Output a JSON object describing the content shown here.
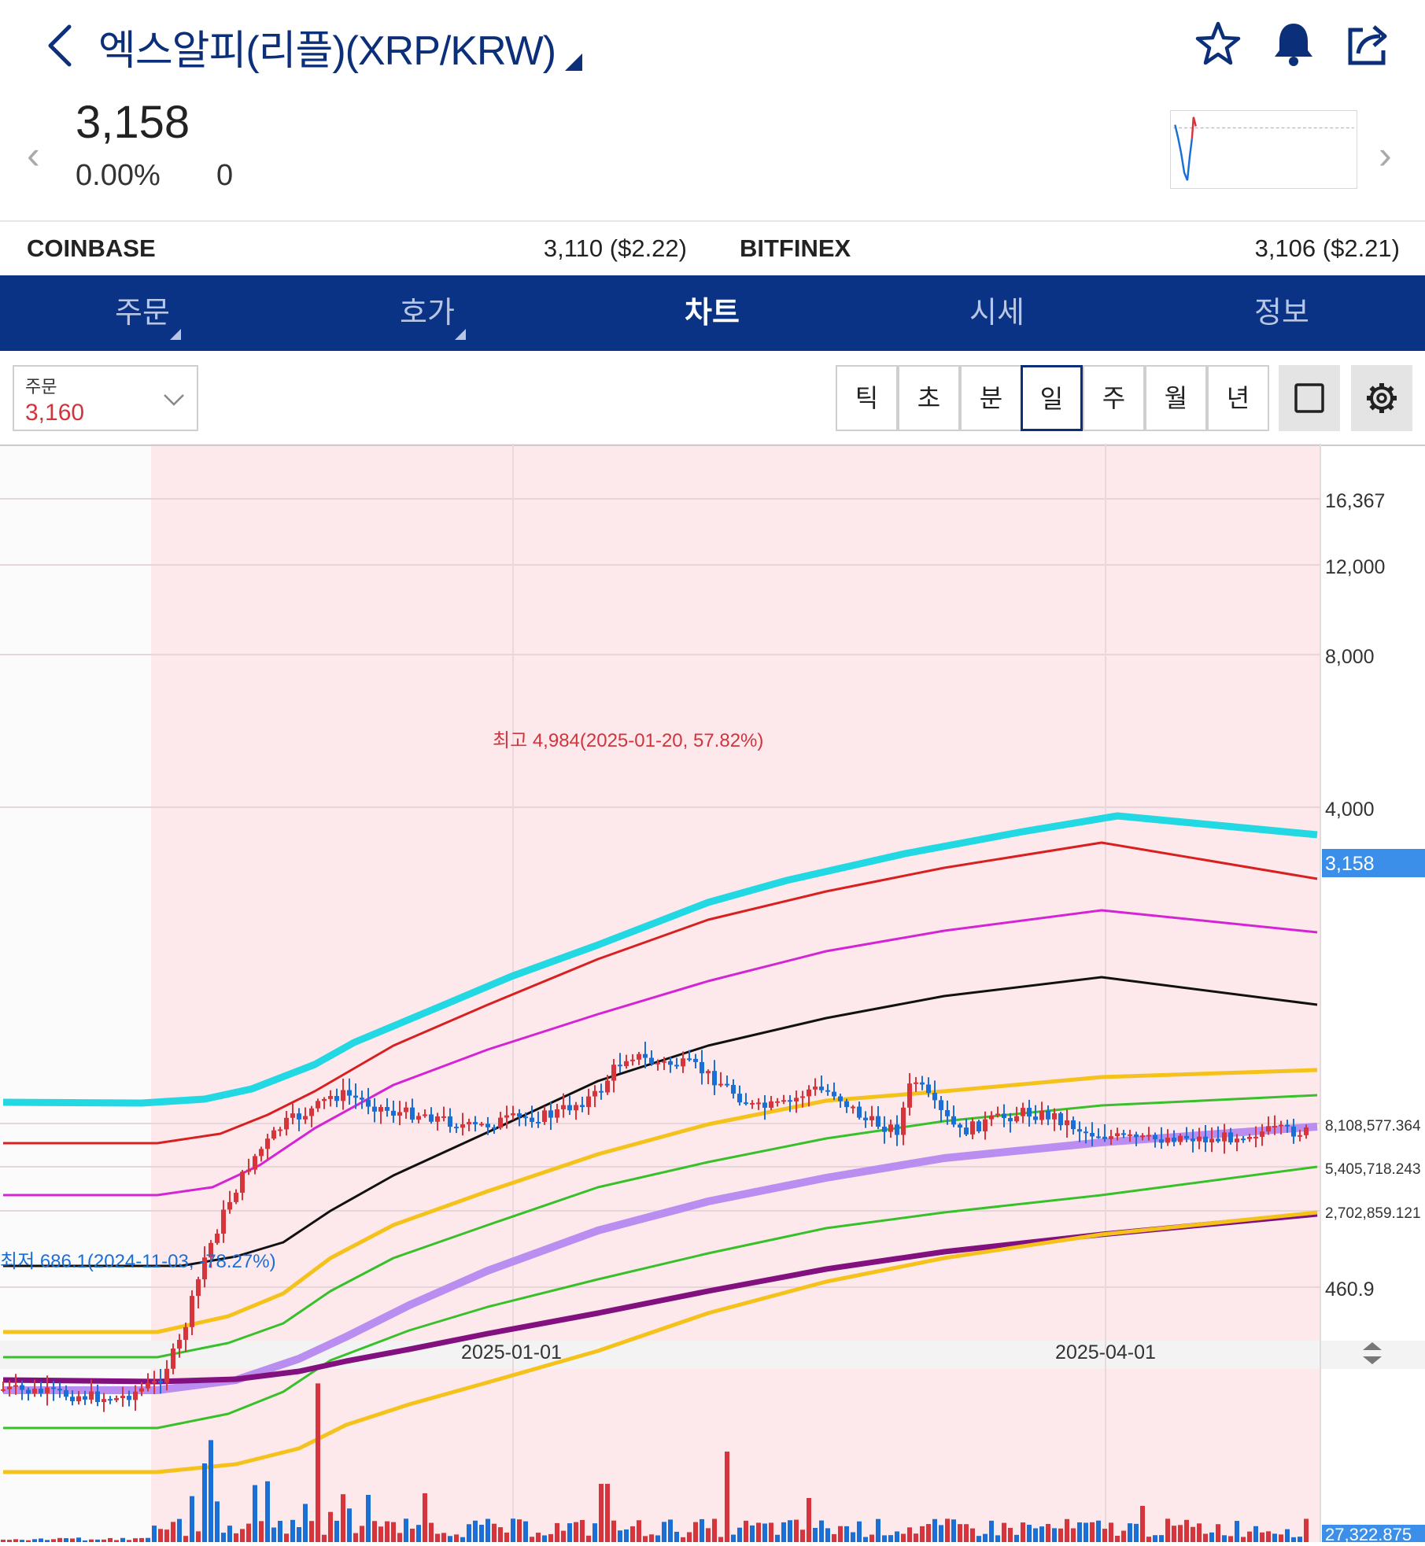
{
  "header": {
    "title": "엑스알피(리플)(XRP/KRW)",
    "icons": [
      "back-icon",
      "star-icon",
      "bell-icon",
      "share-icon"
    ]
  },
  "quote": {
    "price": "3,158",
    "change_pct": "0.00%",
    "change": "0"
  },
  "exchanges": [
    {
      "name": "COINBASE",
      "value": "3,110 ($2.22)"
    },
    {
      "name": "BITFINEX",
      "value": "3,106 ($2.21)"
    }
  ],
  "tabs": [
    {
      "label": "주문",
      "has_caret": true
    },
    {
      "label": "호가",
      "has_caret": true
    },
    {
      "label": "차트",
      "active": true
    },
    {
      "label": "시세"
    },
    {
      "label": "정보"
    }
  ],
  "order_select": {
    "label": "주문",
    "value": "3,160"
  },
  "periods": [
    "틱",
    "초",
    "분",
    "일",
    "주",
    "월",
    "년"
  ],
  "selected_period": "일",
  "colors": {
    "brand_navy": "#0a3386",
    "up_red": "#d8343c",
    "down_blue": "#1a6fd6",
    "highlight_bg": "#fde9ec",
    "price_tag": "#3b8fe8"
  },
  "chart_data": {
    "type": "candlestick",
    "y_scale": "log",
    "y_ticks": [
      "16,367",
      "12,000",
      "8,000",
      "4,000",
      "460.9"
    ],
    "current_price_label": "3,158",
    "x_ticks": [
      "2025-01-01",
      "2025-04-01"
    ],
    "annotations": {
      "high": "최고 4,984(2025-01-20, 57.82%)",
      "low": "최저 686.1(2024-11-03, -78.27%)"
    },
    "volume_ticks": [
      "8,108,577.364",
      "5,405,718.243",
      "2,702,859.121"
    ],
    "volume_current": "27,322.875",
    "series": [
      {
        "name": "",
        "color": "#22d8e2"
      },
      {
        "name": "",
        "color": "#d82020"
      },
      {
        "name": "",
        "color": "#d425d4"
      },
      {
        "name": "",
        "color": "#111111"
      },
      {
        "name": "",
        "color": "#f5c21b"
      },
      {
        "name": "",
        "color": "#38c02a"
      },
      {
        "name": "",
        "color": "#b98ef0"
      },
      {
        "name": "",
        "color": "#82107e"
      }
    ]
  }
}
